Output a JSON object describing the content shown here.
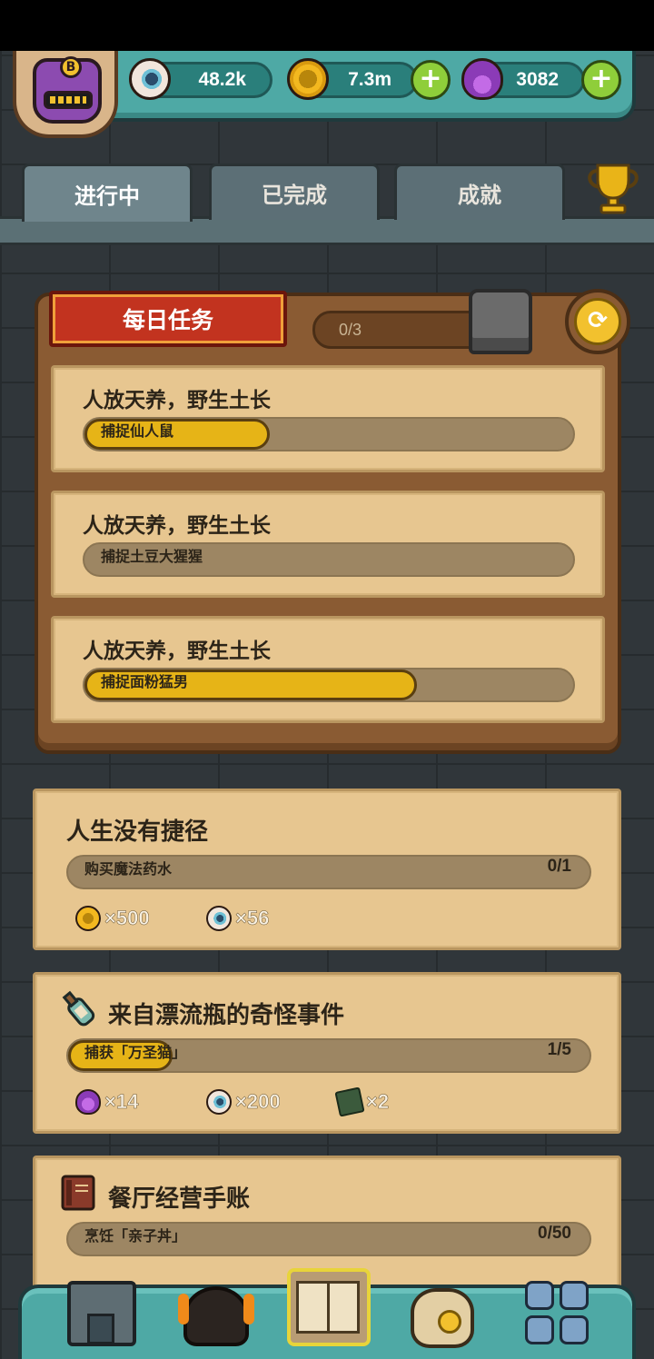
{
  "resources": {
    "eyes": "48.2k",
    "coins": "7.3m",
    "potions": "3082",
    "avatar_badge": "B"
  },
  "tabs": [
    {
      "label": "进行中",
      "active": true
    },
    {
      "label": "已完成",
      "active": false
    },
    {
      "label": "成就",
      "active": false
    }
  ],
  "daily": {
    "title": "每日任务",
    "progress": "0/3",
    "tasks": [
      {
        "title": "人放天养，野生土长",
        "label": "捕捉仙人鼠",
        "fill": 0.38
      },
      {
        "title": "人放天养，野生土长",
        "label": "捕捉土豆大猩猩",
        "fill": 0.0
      },
      {
        "title": "人放天养，野生土长",
        "label": "捕捉面粉猛男",
        "fill": 0.68
      }
    ]
  },
  "quests": [
    {
      "title": "人生没有捷径",
      "label": "购买魔法药水",
      "progress": "0/1",
      "fill": 0.0,
      "rewards": [
        {
          "icon": "coin-icon",
          "amount": "×500"
        },
        {
          "icon": "eye-icon",
          "amount": "×56"
        }
      ]
    },
    {
      "title": "来自漂流瓶的奇怪事件",
      "label": "捕获「万圣猫」",
      "progress": "1/5",
      "fill": 0.2,
      "rewards": [
        {
          "icon": "potion-icon",
          "amount": "×14"
        },
        {
          "icon": "eye-icon",
          "amount": "×200"
        },
        {
          "icon": "card-icon",
          "amount": "×2"
        }
      ]
    },
    {
      "title": "餐厅经营手账",
      "label": "烹饪「亲子丼」",
      "progress": "0/50",
      "fill": 0.0
    }
  ],
  "colors": {
    "accent_teal": "#4ea9a5",
    "gold": "#e6b417",
    "banner_red": "#c2331f",
    "parchment": "#e7c690"
  }
}
